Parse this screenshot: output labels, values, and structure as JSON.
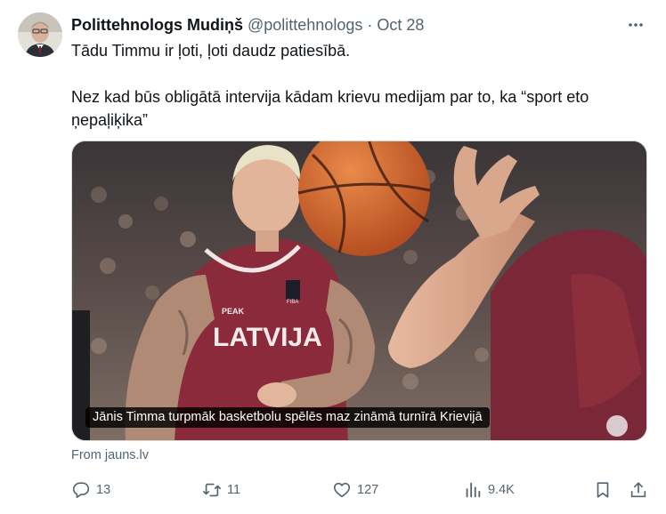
{
  "tweet": {
    "display_name": "Polittehnologs Mudiņš",
    "handle": "@polittehnologs",
    "separator": "·",
    "date": "Oct 28",
    "text_lines": [
      "Tādu Timmu ir ļoti, ļoti daudz patiesībā.",
      "Nez kad būs obligātā intervija kādam krievu medijam par to, ka “sport eto",
      "ņepaļiķika”"
    ],
    "media": {
      "caption": "Jānis Timma turpmāk basketbolu spēlēs maz zināmā turnīrā Krievijā",
      "jersey_text": "LATVIJA",
      "jersey_brand": "PEAK",
      "jersey_patch": "FIBA"
    },
    "link_source": "From jauns.lv"
  },
  "actions": {
    "replies": "13",
    "reposts": "11",
    "likes": "127",
    "views": "9.4K"
  },
  "colors": {
    "text_primary": "#0f1419",
    "text_secondary": "#536471",
    "border": "#cfd9de",
    "jersey": "#8b2a3a"
  },
  "icons": {
    "more": "more-dots-icon",
    "reply": "reply-bubble-icon",
    "repost": "repost-arrows-icon",
    "like": "heart-icon",
    "views": "bar-chart-icon",
    "bookmark": "bookmark-icon",
    "share": "share-upload-icon"
  }
}
